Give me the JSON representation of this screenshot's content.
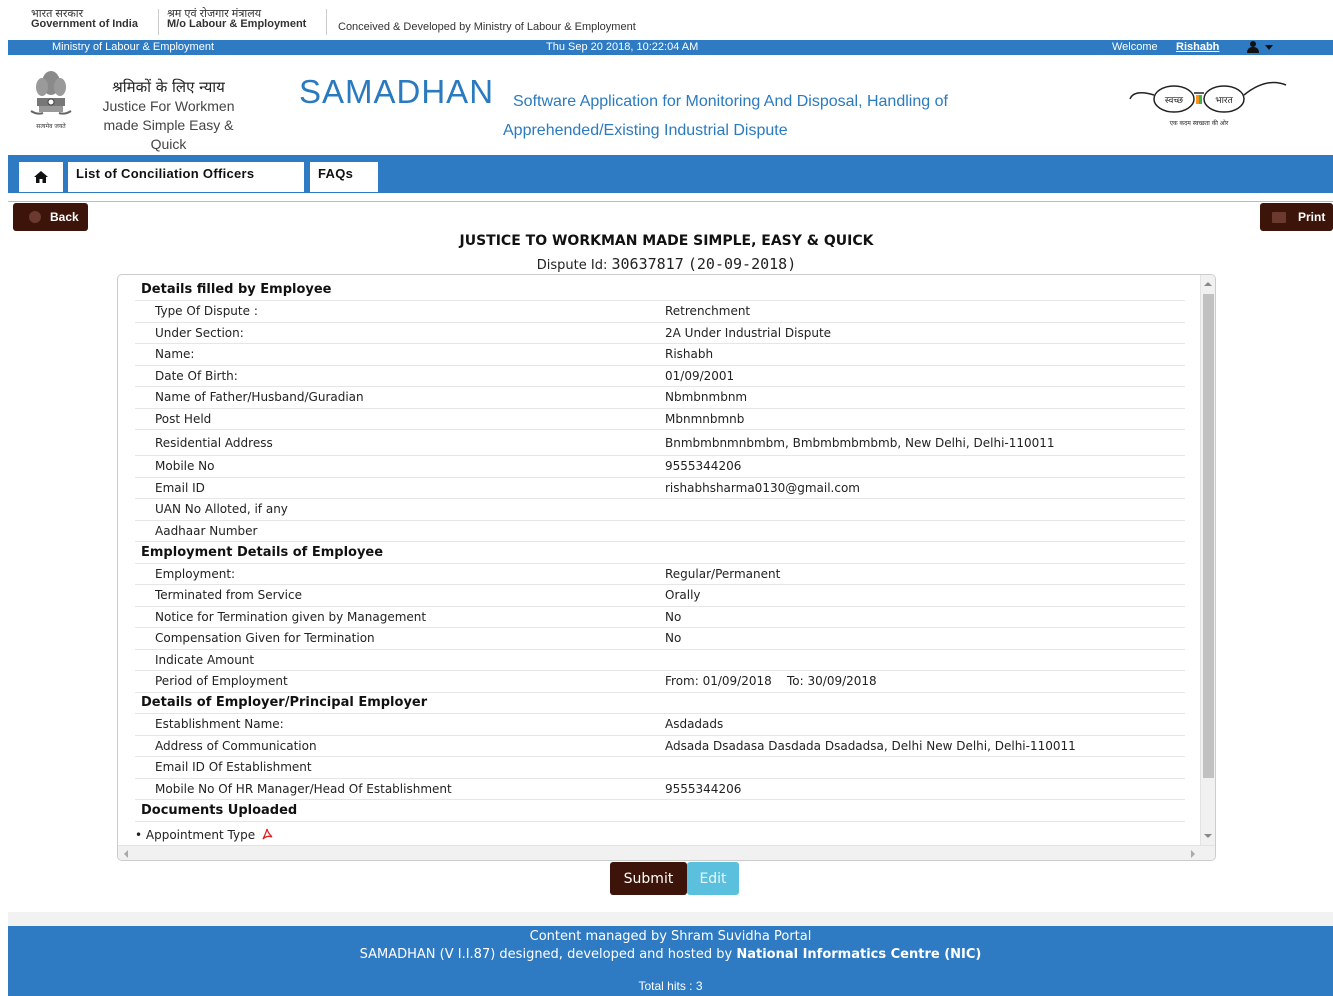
{
  "top_strip": {
    "gov_hi": "भारत सरकार",
    "gov_en": "Government of India",
    "ministry_hi": "श्रम एवं रोजगार मंत्रालय",
    "ministry_en": "M/o Labour & Employment",
    "conceived": "Conceived & Developed by Ministry of Labour & Employment"
  },
  "blue_bar": {
    "ministry": "Ministry of Labour & Employment",
    "datetime": "Thu Sep 20 2018, 10:22:04 AM",
    "welcome": "Welcome",
    "username": "Rishabh"
  },
  "header": {
    "emblem_caption": "सत्यमेव जयते",
    "tagline_hi": "श्रमिकों के लिए न्याय",
    "tagline_en_1": "Justice For Workmen",
    "tagline_en_2": "made Simple Easy &",
    "tagline_en_3": "Quick",
    "brand": "SAMADHAN",
    "brand_sub_1": "Software Application for Monitoring And Disposal, Handling of",
    "brand_sub_2": "Apprehended/Existing Industrial Dispute",
    "swachh_left": "स्वच्छ",
    "swachh_right": "भारत",
    "swachh_caption": "एक कदम स्वच्छता की ओर"
  },
  "nav": {
    "tabs": [
      {
        "label": "List of Conciliation Officers"
      },
      {
        "label": "FAQs"
      }
    ]
  },
  "actions": {
    "back": "Back",
    "print": "Print",
    "submit": "Submit",
    "edit": "Edit"
  },
  "page": {
    "title": "JUSTICE TO WORKMAN MADE SIMPLE, EASY & QUICK",
    "dispute_label": "Dispute Id:",
    "dispute_id": "30637817",
    "dispute_date": "(20-09-2018)"
  },
  "sections": {
    "employee": "Details filled by Employee",
    "employment": "Employment Details of Employee",
    "employer": "Details of Employer/Principal Employer",
    "documents": "Documents Uploaded"
  },
  "employee_rows": [
    {
      "k": "Type Of Dispute :",
      "v": "Retrenchment"
    },
    {
      "k": "Under Section:",
      "v": "2A Under Industrial Dispute"
    },
    {
      "k": "Name:",
      "v": "Rishabh"
    },
    {
      "k": "Date Of Birth:",
      "v": "01/09/2001"
    },
    {
      "k": "Name of Father/Husband/Guradian",
      "v": "Nbmbnmbnm"
    },
    {
      "k": "Post Held",
      "v": "Mbnmnbmnb"
    },
    {
      "k": "Residential Address",
      "v": "Bnmbmbnmnbmbm, Bmbmbmbmbmb, New Delhi, Delhi-110011"
    },
    {
      "k": "Mobile No",
      "v": "9555344206"
    },
    {
      "k": "Email ID",
      "v": "rishabhsharma0130@gmail.com"
    },
    {
      "k": "UAN No Alloted, if any",
      "v": ""
    },
    {
      "k": "Aadhaar Number",
      "v": ""
    }
  ],
  "employment_rows": [
    {
      "k": "Employment:",
      "v": "Regular/Permanent"
    },
    {
      "k": "Terminated from Service",
      "v": "Orally"
    },
    {
      "k": "Notice for Termination given by Management",
      "v": "No"
    },
    {
      "k": "Compensation Given for Termination",
      "v": "No"
    },
    {
      "k": "Indicate Amount",
      "v": ""
    },
    {
      "k": "Period of Employment",
      "v": "From: 01/09/2018    To: 30/09/2018"
    }
  ],
  "employer_rows": [
    {
      "k": "Establishment Name:",
      "v": "Asdadads"
    },
    {
      "k": "Address of Communication",
      "v": "Adsada Dsadasa Dasdada Dsadadsa, Delhi New Delhi, Delhi-110011"
    },
    {
      "k": "Email ID Of Establishment",
      "v": ""
    },
    {
      "k": "Mobile No Of HR Manager/Head Of Establishment",
      "v": "9555344206"
    }
  ],
  "documents": [
    {
      "label": "• Appointment Type",
      "icon": "pdf-icon"
    }
  ],
  "footer": {
    "line1": "Content managed by Shram Suvidha Portal",
    "line2_pre": "SAMADHAN (V I.I.87) designed, developed and hosted by ",
    "line2_bold": "National Informatics Centre (NIC)",
    "hits": "Total hits : 3"
  },
  "colors": {
    "brand_blue": "#2e7bc3",
    "button_dark": "#3d1409",
    "edit_button": "#5bc0de"
  }
}
